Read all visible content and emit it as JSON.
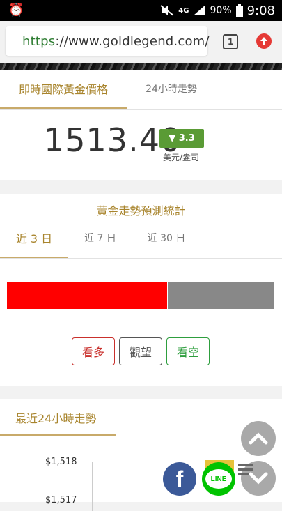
{
  "status_bar": {
    "network": "4G",
    "battery": "90%",
    "time": "9:08"
  },
  "browser": {
    "url_scheme": "https",
    "url_rest": "://www.goldlegend.com/",
    "tab_count": "1"
  },
  "price_tabs": [
    {
      "label": "即時國際黃金價格",
      "active": true
    },
    {
      "label": "24小時走勢",
      "active": false
    }
  ],
  "quote": {
    "price": "1513.40",
    "change": "▼ 3.3",
    "unit": "美元/盎司",
    "change_color": "#5a9b35"
  },
  "forecast": {
    "title": "黃金走勢預測統計",
    "periods": [
      {
        "label": "近 3 日",
        "active": true
      },
      {
        "label": "近 7 日",
        "active": false
      },
      {
        "label": "近 30 日",
        "active": false
      }
    ],
    "bullish_share": 0.6,
    "buttons": [
      {
        "label": "看多",
        "color": "#c9302c"
      },
      {
        "label": "觀望",
        "color": "#555555"
      },
      {
        "label": "看空",
        "color": "#2e9e3e"
      }
    ]
  },
  "trend_24h": {
    "title": "最近24小時走勢",
    "y_ticks": [
      "$1,518",
      "$1,517"
    ]
  },
  "fabs": {
    "facebook": "f",
    "line": "LINE"
  },
  "colors": {
    "accent_gold": "#a8842c",
    "bullish_red": "#ff0000",
    "neutral_grey": "#888888"
  }
}
